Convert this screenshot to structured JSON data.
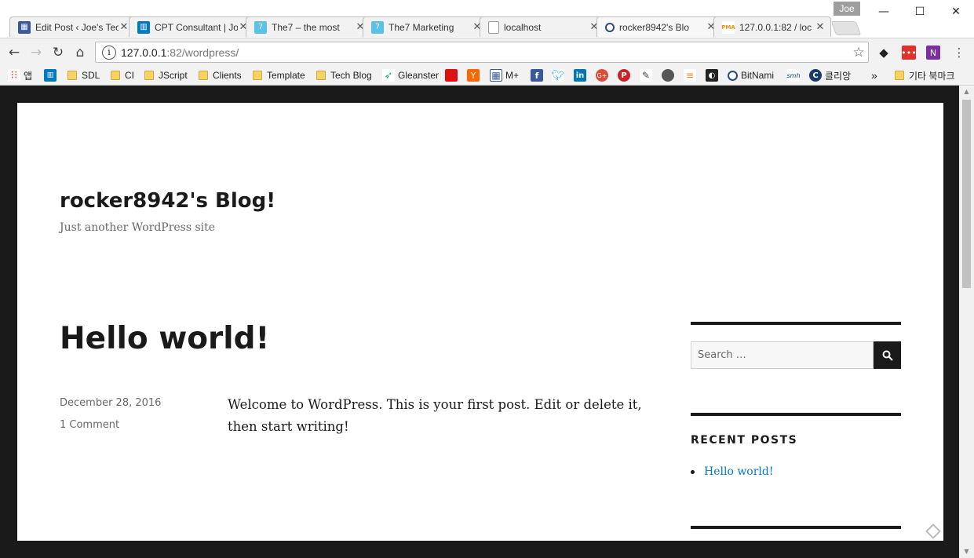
{
  "browser": {
    "profile": "Joe",
    "tabs": [
      {
        "title": "Edit Post ‹ Joe's Tec",
        "icon": "grid-icon",
        "color": "#3b5a9a"
      },
      {
        "title": "CPT Consultant | Joe",
        "icon": "trello-icon",
        "color": "#0079bf"
      },
      {
        "title": "The7 – the most",
        "icon": "the7-icon",
        "color": "#5bc2e7"
      },
      {
        "title": "The7 Marketing",
        "icon": "the7-icon",
        "color": "#5bc2e7"
      },
      {
        "title": "localhost",
        "icon": "page-icon",
        "color": "#777777"
      },
      {
        "title": "rocker8942's Blo",
        "icon": "bitnami-icon",
        "color": "#2a4b7c"
      },
      {
        "title": "127.0.0.1:82 / loc",
        "icon": "phpmyadmin-icon",
        "color": "#f29111"
      }
    ],
    "url_host": "127.0.0.1",
    "url_path": ":82/wordpress/",
    "bookmarks": [
      {
        "label": "앱",
        "type": "apps"
      },
      {
        "label": "",
        "type": "trello"
      },
      {
        "label": "SDL",
        "type": "folder"
      },
      {
        "label": "CI",
        "type": "folder"
      },
      {
        "label": "JScript",
        "type": "folder"
      },
      {
        "label": "Clients",
        "type": "folder"
      },
      {
        "label": "Template",
        "type": "folder"
      },
      {
        "label": "Tech Blog",
        "type": "folder"
      },
      {
        "label": "Gleanster",
        "type": "gleanster"
      },
      {
        "label": "M+",
        "type": "grid"
      },
      {
        "label": "BitNami",
        "type": "bitnami"
      },
      {
        "label": "클리앙",
        "type": "clien"
      },
      {
        "label": "기타 북마크",
        "type": "folder"
      }
    ],
    "overflow": "»"
  },
  "site": {
    "title": "rocker8942's Blog!",
    "description": "Just another WordPress site"
  },
  "post": {
    "title": "Hello world!",
    "date": "December 28, 2016",
    "comments": "1 Comment",
    "body": "Welcome to WordPress. This is your first post. Edit or delete it, then start writing!"
  },
  "sidebar": {
    "search_placeholder": "Search …",
    "recent_posts_title": "RECENT POSTS",
    "recent_posts": [
      "Hello world!"
    ]
  },
  "colors": {
    "link": "#007acc",
    "text": "#1a1a1a",
    "meta": "#686868"
  }
}
